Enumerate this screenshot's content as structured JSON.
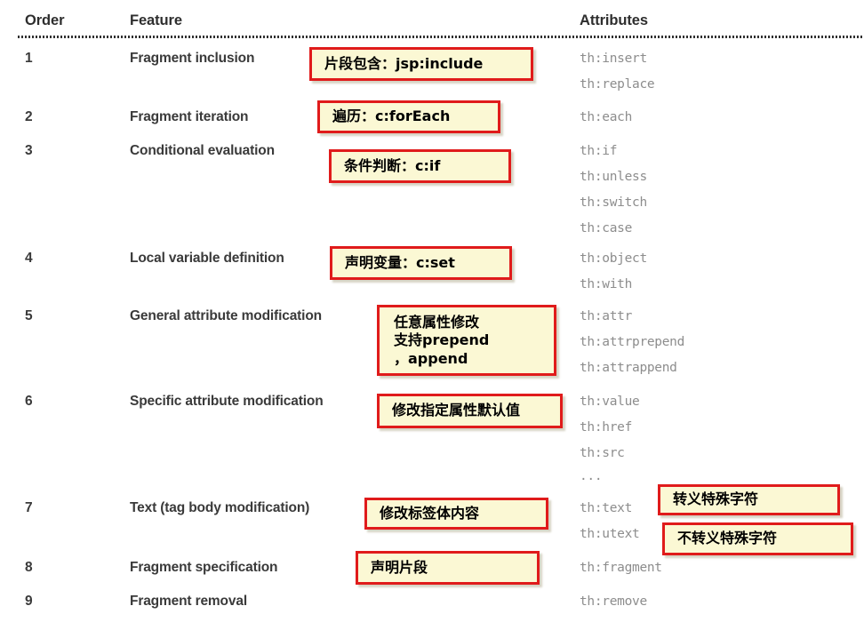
{
  "table": {
    "headers": {
      "order": "Order",
      "feature": "Feature",
      "attributes": "Attributes"
    },
    "rows": [
      {
        "order": "1",
        "feature": "Fragment inclusion",
        "attributes": [
          "th:insert",
          "th:replace"
        ]
      },
      {
        "order": "2",
        "feature": "Fragment iteration",
        "attributes": [
          "th:each"
        ]
      },
      {
        "order": "3",
        "feature": "Conditional evaluation",
        "attributes": [
          "th:if",
          "th:unless",
          "th:switch",
          "th:case"
        ]
      },
      {
        "order": "4",
        "feature": "Local variable definition",
        "attributes": [
          "th:object",
          "th:with"
        ]
      },
      {
        "order": "5",
        "feature": "General attribute modification",
        "attributes": [
          "th:attr",
          "th:attrprepend",
          "th:attrappend"
        ]
      },
      {
        "order": "6",
        "feature": "Specific attribute modification",
        "attributes": [
          "th:value",
          "th:href",
          "th:src",
          "..."
        ]
      },
      {
        "order": "7",
        "feature": "Text (tag body modification)",
        "attributes": [
          "th:text",
          "th:utext"
        ]
      },
      {
        "order": "8",
        "feature": "Fragment specification",
        "attributes": [
          "th:fragment"
        ]
      },
      {
        "order": "9",
        "feature": "Fragment removal",
        "attributes": [
          "th:remove"
        ]
      }
    ]
  },
  "annotations": [
    {
      "id": "note-fragment-inclusion",
      "text": "片段包含：jsp:include"
    },
    {
      "id": "note-fragment-iteration",
      "text": "遍历：c:forEach"
    },
    {
      "id": "note-conditional",
      "text": "条件判断：c:if"
    },
    {
      "id": "note-local-variable",
      "text": "声明变量：c:set"
    },
    {
      "id": "note-general-attribute",
      "lines": [
        "任意属性修改",
        "支持prepend",
        "，append"
      ]
    },
    {
      "id": "note-specific-attribute",
      "text": "修改指定属性默认值"
    },
    {
      "id": "note-text-body",
      "text": "修改标签体内容"
    },
    {
      "id": "note-escaped",
      "text": "转义特殊字符"
    },
    {
      "id": "note-unescaped",
      "text": "不转义特殊字符"
    },
    {
      "id": "note-fragment-spec",
      "text": "声明片段"
    }
  ],
  "colors": {
    "note_fill": "#fbf8d4",
    "note_border": "#e01b1b",
    "attribute_text": "#8d8d8d",
    "body_text": "#3a3a3a",
    "background": "#ffffff"
  }
}
